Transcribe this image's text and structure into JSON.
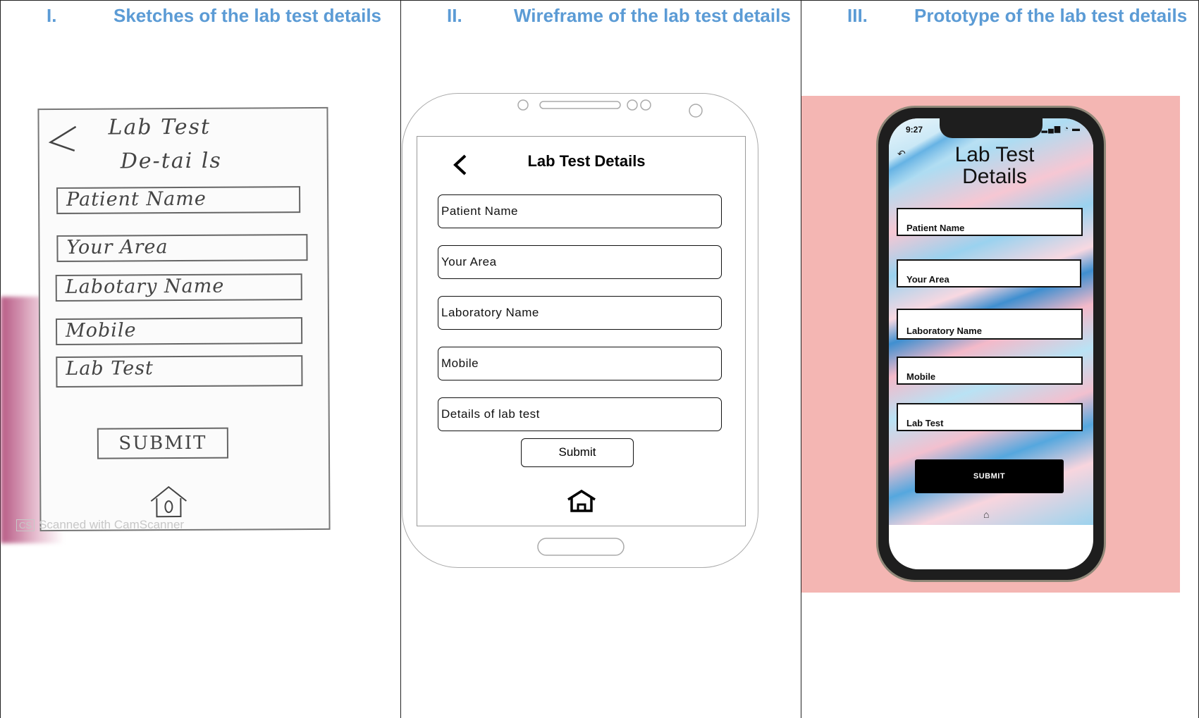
{
  "columns": [
    {
      "numeral": "I.",
      "heading": "Sketches of the lab test details"
    },
    {
      "numeral": "II.",
      "heading": "Wireframe of the lab test details"
    },
    {
      "numeral": "III.",
      "heading": "Prototype of the lab test details"
    }
  ],
  "sketch": {
    "title_line1": "Lab Test",
    "title_line2": "De-tai ls",
    "fields": [
      "Patient  Name",
      "Your  Area",
      "Labotary Name",
      "Mobile",
      "Lab  Test"
    ],
    "submit_label": "SUBMIT",
    "watermark": "Scanned with CamScanner",
    "watermark_logo": "CS"
  },
  "wireframe": {
    "title": "Lab Test Details",
    "fields": [
      "Patient Name",
      "Your Area",
      "Laboratory Name",
      "Mobile",
      "Details of lab test"
    ],
    "submit_label": "Submit"
  },
  "prototype": {
    "time": "9:27",
    "title": "Lab Test Details",
    "fields": [
      "Patient Name",
      "Your Area",
      "Laboratory Name",
      "Mobile",
      "Lab Test"
    ],
    "submit_label": "SUBMIT",
    "colors": {
      "background": "#f4b6b3",
      "button": "#000000",
      "heading_blue": "#5b9bd5"
    }
  }
}
